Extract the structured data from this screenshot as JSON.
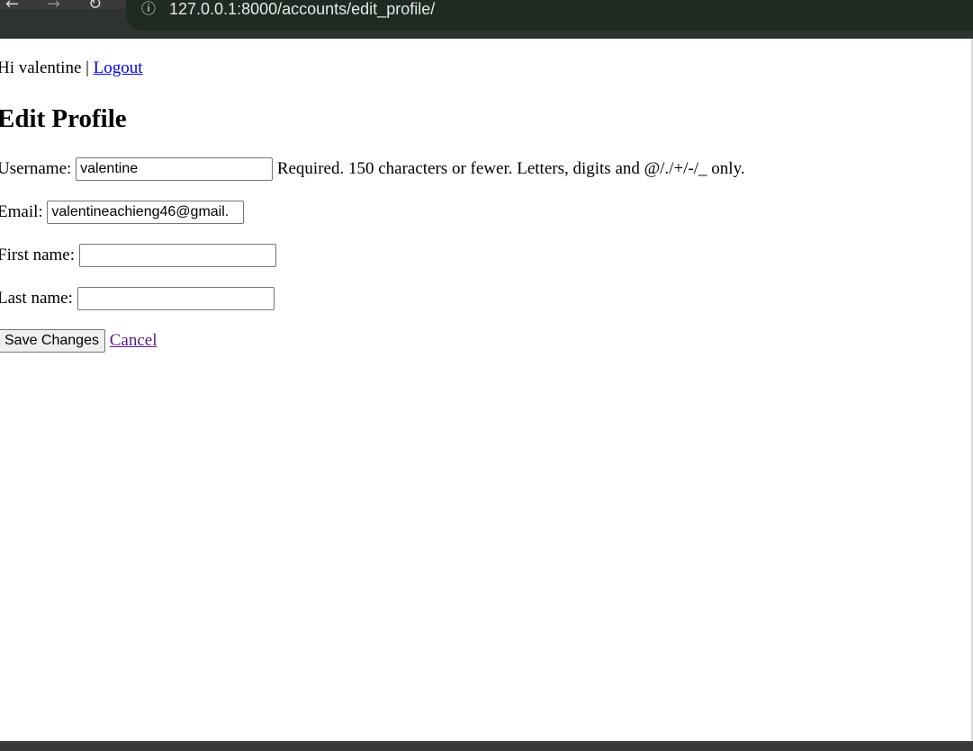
{
  "browser": {
    "url": "127.0.0.1:8000/accounts/edit_profile/"
  },
  "header": {
    "greeting": "Hi valentine |",
    "logout_label": "Logout"
  },
  "page_title": "Edit Profile",
  "form": {
    "username": {
      "label": "Username:",
      "value": "valentine",
      "help": "Required. 150 characters or fewer. Letters, digits and @/./+/-/_ only."
    },
    "email": {
      "label": "Email:",
      "value": "valentineachieng46@gmail."
    },
    "first_name": {
      "label": "First name:",
      "value": ""
    },
    "last_name": {
      "label": "Last name:",
      "value": ""
    },
    "save_label": "Save Changes",
    "cancel_label": "Cancel"
  }
}
